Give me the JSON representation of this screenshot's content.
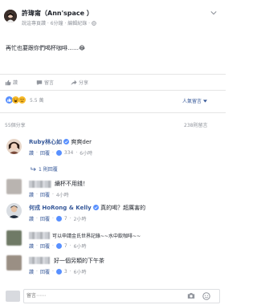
{
  "post": {
    "author": "許瑋甯（Ann'space ）",
    "author_sub": "說這專頁讚 · 6分鐘 · 編輯紀錄 ·",
    "chevron": "chevron-down-icon",
    "body_text": "再忙也要跟你們喝杯咖啡……😂",
    "actions": {
      "like": "讚",
      "comment": "留言",
      "share": "分享"
    },
    "reaction_count": "5.5 萬",
    "sort_label": "人氣留言",
    "shares": "55個分享",
    "comments_total": "238則留言"
  },
  "comments": [
    {
      "author": "Ruby林心如",
      "verified": true,
      "text": "爽爽der",
      "like": "讚",
      "reply": "回覆",
      "likes": "334",
      "time": "6小時",
      "replies_link": "1 則回覆"
    },
    {
      "author": "",
      "text": "續杯不用錢！",
      "like": "讚",
      "reply": "回覆",
      "likes": "",
      "time": "4小時"
    },
    {
      "author": "何戎 HoRong & Kelly",
      "verified": true,
      "text": "真的喝？超厲害的",
      "like": "讚",
      "reply": "回覆",
      "likes": "7",
      "time": "2小時"
    },
    {
      "author": "",
      "text": "可以申請金氏世界記錄~~水中飲咖啡~~",
      "like": "讚",
      "reply": "回覆",
      "likes": "7",
      "time": "6小時"
    },
    {
      "author": "",
      "text": "好一個另類的下午茶",
      "like": "讚",
      "reply": "回覆",
      "likes": "3",
      "time": "6小時"
    }
  ],
  "composer": {
    "placeholder": "留言⋯⋯"
  },
  "colors": {
    "link": "#365899",
    "muted": "#90949c",
    "like_blue": "#5890ff",
    "haha_yellow": "#f7b928"
  }
}
